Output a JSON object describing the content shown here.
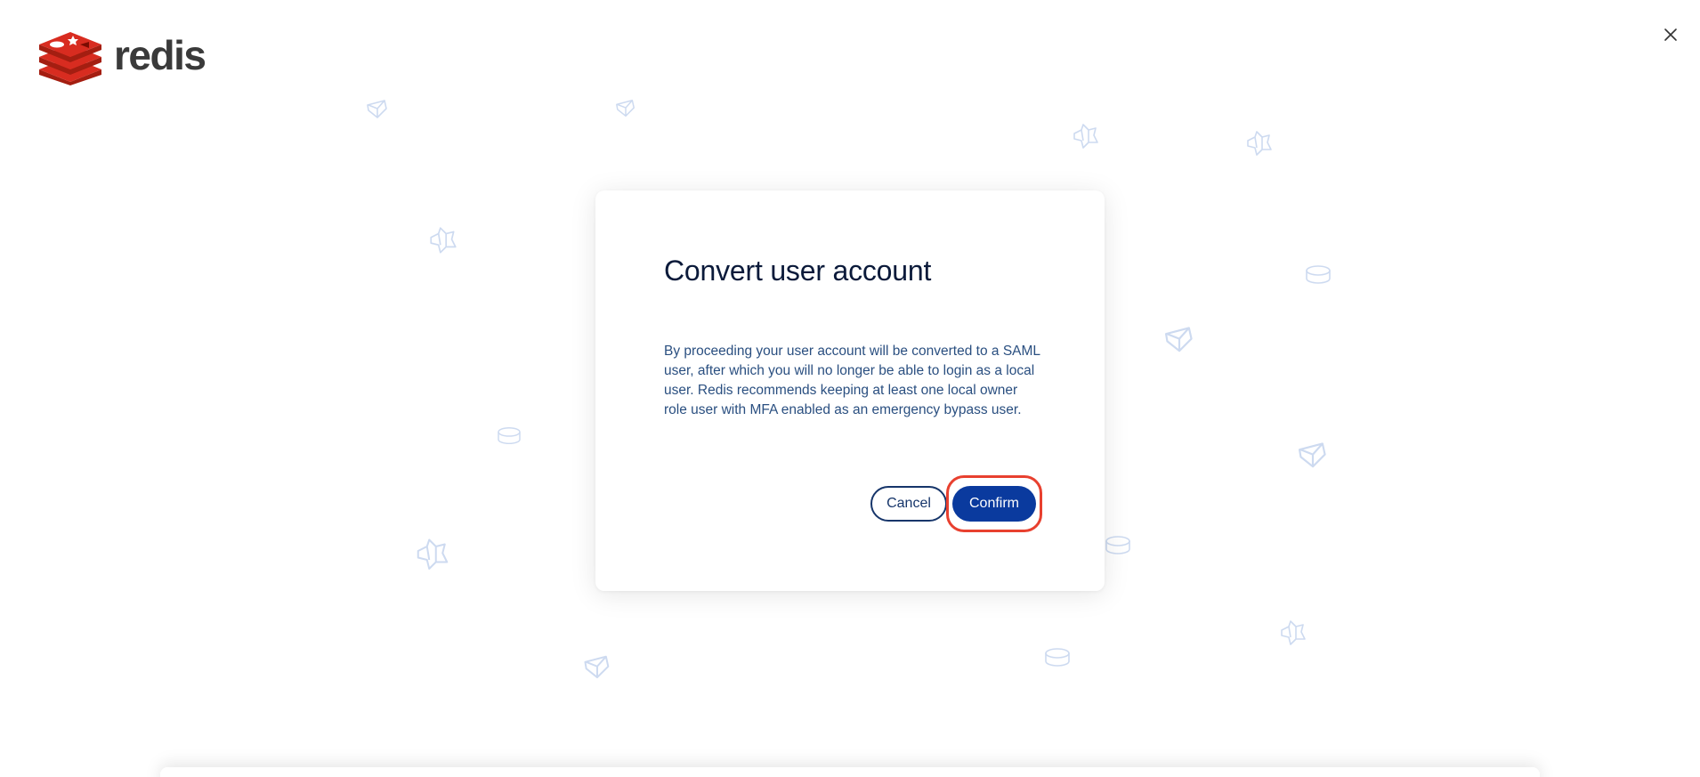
{
  "brand": {
    "name": "redis",
    "logo_icon": "redis-stack-icon",
    "logo_color": "#d82c20"
  },
  "header": {
    "close_icon": "close-icon"
  },
  "dialog": {
    "title": "Convert user account",
    "body": "By proceeding your user account will be converted to a SAML user, after which you will no longer be able to login as a local user. Redis recommends keeping at least one local owner role user with MFA enabled as an emergency bypass user.",
    "cancel_label": "Cancel",
    "confirm_label": "Confirm"
  },
  "colors": {
    "accent": "#0a3a9e",
    "title": "#0b1a3a",
    "body_text": "#2a4f80",
    "highlight": "#e8402f",
    "decor": "#cddaf0"
  }
}
